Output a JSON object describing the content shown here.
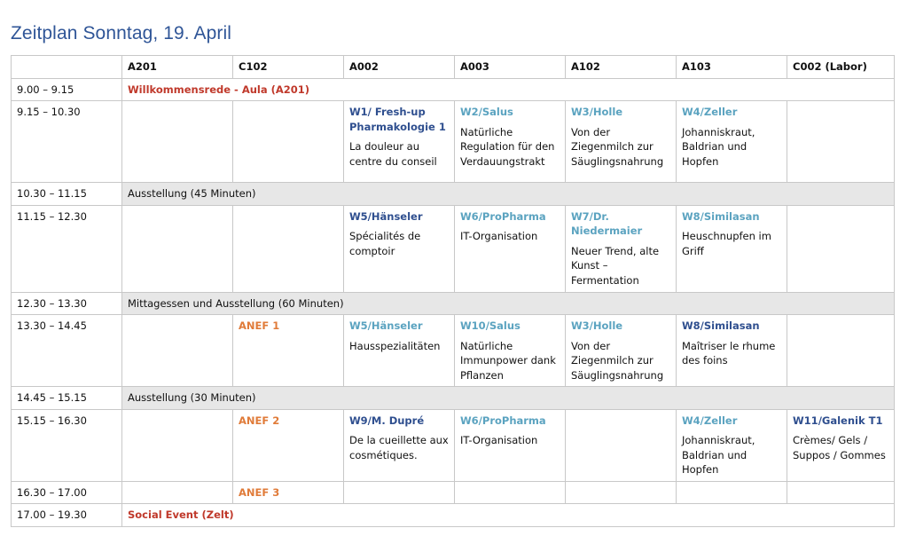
{
  "title": "Zeitplan Sonntag, 19. April",
  "headers": [
    "",
    "A201",
    "C102",
    "A002",
    "A003",
    "A102",
    "A103",
    "C002 (Labor)"
  ],
  "rows": {
    "r1": {
      "time": "9.00 – 9.15",
      "span": "Willkommensrede - Aula (A201)"
    },
    "r2": {
      "time": "9.15 – 10.30",
      "a002": {
        "title": "W1/ Fresh-up Pharmakologie 1",
        "desc": "La douleur au centre du conseil"
      },
      "a003": {
        "title": "W2/Salus",
        "desc": "Natürliche Regulation für den Verdauungstrakt"
      },
      "a102": {
        "title": "W3/Holle",
        "desc": "Von der Ziegenmilch zur Säuglingsnahrung"
      },
      "a103": {
        "title": "W4/Zeller",
        "desc": "Johanniskraut, Baldrian und Hopfen"
      }
    },
    "r3": {
      "time": "10.30 – 11.15",
      "span": "Ausstellung (45 Minuten)"
    },
    "r4": {
      "time": "11.15 – 12.30",
      "a002": {
        "title": "W5/Hänseler",
        "desc": "Spécialités de comptoir"
      },
      "a003": {
        "title": "W6/ProPharma",
        "desc": "IT-Organisation"
      },
      "a102": {
        "title": "W7/Dr. Niedermaier",
        "desc": "Neuer Trend, alte Kunst – Fermentation"
      },
      "a103": {
        "title": "W8/Similasan",
        "desc": "Heuschnupfen im Griff"
      }
    },
    "r5": {
      "time": "12.30 – 13.30",
      "span": "Mittagessen und Ausstellung (60 Minuten)"
    },
    "r6": {
      "time": "13.30 – 14.45",
      "c102": "ANEF 1",
      "a002": {
        "title": "W5/Hänseler",
        "desc": "Hausspezialitäten"
      },
      "a003": {
        "title": "W10/Salus",
        "desc": "Natürliche Immunpower dank Pflanzen"
      },
      "a102": {
        "title": "W3/Holle",
        "desc": "Von der Ziegenmilch zur Säuglingsnahrung"
      },
      "a103": {
        "title": "W8/Similasan",
        "desc": "Maîtriser le rhume des foins"
      }
    },
    "r7": {
      "time": "14.45 – 15.15",
      "span": "Ausstellung (30 Minuten)"
    },
    "r8": {
      "time": "15.15 – 16.30",
      "c102": "ANEF 2",
      "a002": {
        "title": "W9/M. Dupré",
        "desc": "De la cueillette aux cosmétiques."
      },
      "a003": {
        "title": "W6/ProPharma",
        "desc": "IT-Organisation"
      },
      "a103": {
        "title": "W4/Zeller",
        "desc": "Johanniskraut, Baldrian und Hopfen"
      },
      "c002": {
        "title": "W11/Galenik T1",
        "desc": "Crèmes/ Gels / Suppos / Gommes"
      }
    },
    "r9": {
      "time": "16.30 – 17.00",
      "c102": "ANEF 3"
    },
    "r10": {
      "time": "17.00 – 19.30",
      "span": "Social Event (Zelt)"
    }
  },
  "colors": {
    "title": "#2f5597",
    "navy": "#2f4f8f",
    "teal": "#5ba3c0",
    "orange": "#e07b39",
    "red": "#c0392b",
    "gray_band": "#e7e7e7"
  }
}
